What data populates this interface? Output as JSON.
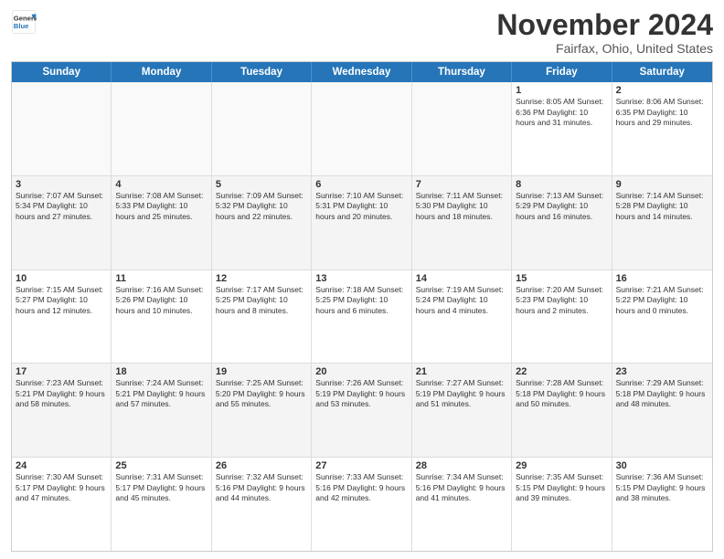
{
  "header": {
    "logo_line1": "General",
    "logo_line2": "Blue",
    "month": "November 2024",
    "location": "Fairfax, Ohio, United States"
  },
  "days_of_week": [
    "Sunday",
    "Monday",
    "Tuesday",
    "Wednesday",
    "Thursday",
    "Friday",
    "Saturday"
  ],
  "weeks": [
    [
      {
        "day": "",
        "empty": true
      },
      {
        "day": "",
        "empty": true
      },
      {
        "day": "",
        "empty": true
      },
      {
        "day": "",
        "empty": true
      },
      {
        "day": "",
        "empty": true
      },
      {
        "day": "1",
        "text": "Sunrise: 8:05 AM\nSunset: 6:36 PM\nDaylight: 10 hours\nand 31 minutes."
      },
      {
        "day": "2",
        "text": "Sunrise: 8:06 AM\nSunset: 6:35 PM\nDaylight: 10 hours\nand 29 minutes."
      }
    ],
    [
      {
        "day": "3",
        "text": "Sunrise: 7:07 AM\nSunset: 5:34 PM\nDaylight: 10 hours\nand 27 minutes."
      },
      {
        "day": "4",
        "text": "Sunrise: 7:08 AM\nSunset: 5:33 PM\nDaylight: 10 hours\nand 25 minutes."
      },
      {
        "day": "5",
        "text": "Sunrise: 7:09 AM\nSunset: 5:32 PM\nDaylight: 10 hours\nand 22 minutes."
      },
      {
        "day": "6",
        "text": "Sunrise: 7:10 AM\nSunset: 5:31 PM\nDaylight: 10 hours\nand 20 minutes."
      },
      {
        "day": "7",
        "text": "Sunrise: 7:11 AM\nSunset: 5:30 PM\nDaylight: 10 hours\nand 18 minutes."
      },
      {
        "day": "8",
        "text": "Sunrise: 7:13 AM\nSunset: 5:29 PM\nDaylight: 10 hours\nand 16 minutes."
      },
      {
        "day": "9",
        "text": "Sunrise: 7:14 AM\nSunset: 5:28 PM\nDaylight: 10 hours\nand 14 minutes."
      }
    ],
    [
      {
        "day": "10",
        "text": "Sunrise: 7:15 AM\nSunset: 5:27 PM\nDaylight: 10 hours\nand 12 minutes."
      },
      {
        "day": "11",
        "text": "Sunrise: 7:16 AM\nSunset: 5:26 PM\nDaylight: 10 hours\nand 10 minutes."
      },
      {
        "day": "12",
        "text": "Sunrise: 7:17 AM\nSunset: 5:25 PM\nDaylight: 10 hours\nand 8 minutes."
      },
      {
        "day": "13",
        "text": "Sunrise: 7:18 AM\nSunset: 5:25 PM\nDaylight: 10 hours\nand 6 minutes."
      },
      {
        "day": "14",
        "text": "Sunrise: 7:19 AM\nSunset: 5:24 PM\nDaylight: 10 hours\nand 4 minutes."
      },
      {
        "day": "15",
        "text": "Sunrise: 7:20 AM\nSunset: 5:23 PM\nDaylight: 10 hours\nand 2 minutes."
      },
      {
        "day": "16",
        "text": "Sunrise: 7:21 AM\nSunset: 5:22 PM\nDaylight: 10 hours\nand 0 minutes."
      }
    ],
    [
      {
        "day": "17",
        "text": "Sunrise: 7:23 AM\nSunset: 5:21 PM\nDaylight: 9 hours\nand 58 minutes."
      },
      {
        "day": "18",
        "text": "Sunrise: 7:24 AM\nSunset: 5:21 PM\nDaylight: 9 hours\nand 57 minutes."
      },
      {
        "day": "19",
        "text": "Sunrise: 7:25 AM\nSunset: 5:20 PM\nDaylight: 9 hours\nand 55 minutes."
      },
      {
        "day": "20",
        "text": "Sunrise: 7:26 AM\nSunset: 5:19 PM\nDaylight: 9 hours\nand 53 minutes."
      },
      {
        "day": "21",
        "text": "Sunrise: 7:27 AM\nSunset: 5:19 PM\nDaylight: 9 hours\nand 51 minutes."
      },
      {
        "day": "22",
        "text": "Sunrise: 7:28 AM\nSunset: 5:18 PM\nDaylight: 9 hours\nand 50 minutes."
      },
      {
        "day": "23",
        "text": "Sunrise: 7:29 AM\nSunset: 5:18 PM\nDaylight: 9 hours\nand 48 minutes."
      }
    ],
    [
      {
        "day": "24",
        "text": "Sunrise: 7:30 AM\nSunset: 5:17 PM\nDaylight: 9 hours\nand 47 minutes."
      },
      {
        "day": "25",
        "text": "Sunrise: 7:31 AM\nSunset: 5:17 PM\nDaylight: 9 hours\nand 45 minutes."
      },
      {
        "day": "26",
        "text": "Sunrise: 7:32 AM\nSunset: 5:16 PM\nDaylight: 9 hours\nand 44 minutes."
      },
      {
        "day": "27",
        "text": "Sunrise: 7:33 AM\nSunset: 5:16 PM\nDaylight: 9 hours\nand 42 minutes."
      },
      {
        "day": "28",
        "text": "Sunrise: 7:34 AM\nSunset: 5:16 PM\nDaylight: 9 hours\nand 41 minutes."
      },
      {
        "day": "29",
        "text": "Sunrise: 7:35 AM\nSunset: 5:15 PM\nDaylight: 9 hours\nand 39 minutes."
      },
      {
        "day": "30",
        "text": "Sunrise: 7:36 AM\nSunset: 5:15 PM\nDaylight: 9 hours\nand 38 minutes."
      }
    ]
  ]
}
